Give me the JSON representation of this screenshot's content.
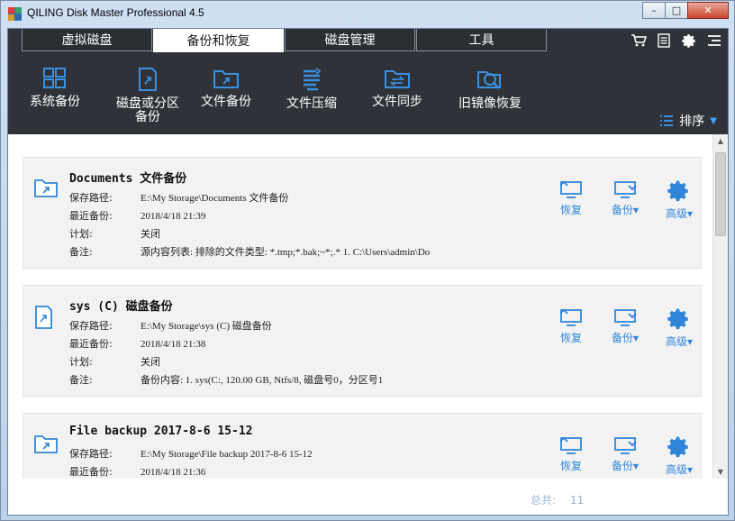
{
  "window": {
    "title": "QILING Disk Master Professional 4.5",
    "buttons": {
      "minimize": "–",
      "maximize": "□",
      "close": "✕"
    }
  },
  "tabs": [
    {
      "label": "虚拟磁盘",
      "active": false
    },
    {
      "label": "备份和恢复",
      "active": true
    },
    {
      "label": "磁盘管理",
      "active": false
    },
    {
      "label": "工具",
      "active": false
    }
  ],
  "top_icons": [
    "cart-icon",
    "list-icon",
    "gear-icon",
    "menu-icon"
  ],
  "toolbar": [
    {
      "label": "系统备份",
      "icon": "windows-icon"
    },
    {
      "label": "磁盘或分区备份",
      "icon": "disk-backup-icon"
    },
    {
      "label": "文件备份",
      "icon": "folder-backup-icon"
    },
    {
      "label": "文件压缩",
      "icon": "compress-icon"
    },
    {
      "label": "文件同步",
      "icon": "folder-sync-icon"
    },
    {
      "label": "旧镜像恢复",
      "icon": "image-restore-icon"
    }
  ],
  "sort_label": "排序",
  "labels": {
    "save_path": "保存路径:",
    "last_backup": "最近备份:",
    "schedule": "计划:",
    "note": "备注:",
    "restore": "恢复",
    "backup": "备份▾",
    "advanced": "高级▾"
  },
  "backups": [
    {
      "name": "Documents 文件备份",
      "path": "E:\\My Storage\\Documents 文件备份",
      "last": "2018/4/18 21:39",
      "schedule": "关闭",
      "note": "源内容列表:   排除的文件类型:  *.tmp;*.bak;~*;.*      1. C:\\Users\\admin\\Do"
    },
    {
      "name": "sys (C) 磁盘备份",
      "path": "E:\\My Storage\\sys (C) 磁盘备份",
      "last": "2018/4/18 21:38",
      "schedule": "关闭",
      "note": "备份内容:   1. sys(C:, 120.00 GB, Ntfs/8, 磁盘号0，分区号1"
    },
    {
      "name": "File backup 2017-8-6 15-12",
      "path": "E:\\My Storage\\File backup 2017-8-6 15-12",
      "last": "2018/4/18 21:36",
      "schedule": "",
      "note": ""
    }
  ],
  "footer": {
    "total_label": "总共:",
    "total_count": "11"
  },
  "colors": {
    "accent": "#2f86d8",
    "dark_header": "#2f3339",
    "card_bg": "#f2f2f2"
  }
}
